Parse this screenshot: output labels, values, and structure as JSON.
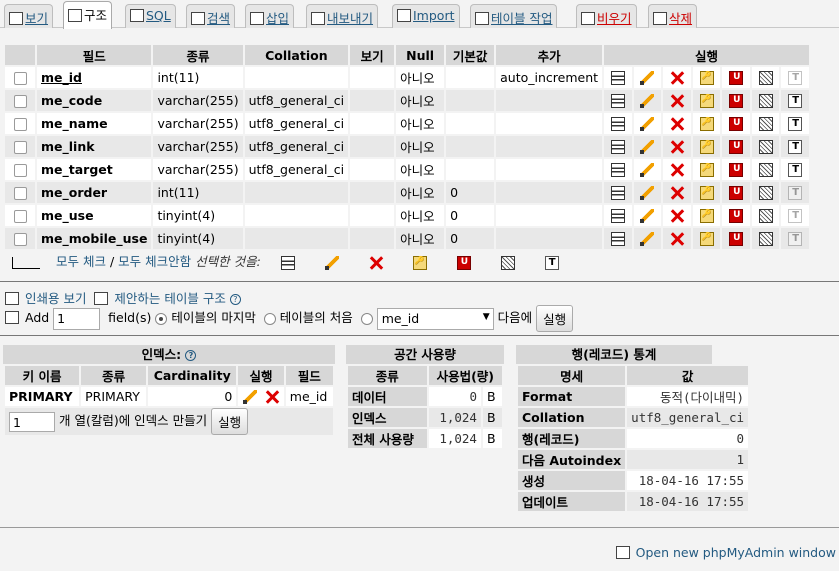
{
  "tabs": [
    {
      "label": "보기",
      "icon": "browse-icon"
    },
    {
      "label": "구조",
      "icon": "structure-icon",
      "active": true
    },
    {
      "label": "SQL",
      "icon": "sql-icon"
    },
    {
      "label": "검색",
      "icon": "search-icon"
    },
    {
      "label": "삽입",
      "icon": "insert-icon"
    },
    {
      "label": "내보내기",
      "icon": "export-icon"
    },
    {
      "label": "Import",
      "icon": "import-icon"
    },
    {
      "label": "테이블 작업",
      "icon": "operations-icon"
    },
    {
      "label": "비우기",
      "icon": "empty-icon"
    },
    {
      "label": "삭제",
      "icon": "drop-icon"
    }
  ],
  "structure": {
    "headers": {
      "field": "필드",
      "type": "종류",
      "collation": "Collation",
      "attributes": "보기",
      "null": "Null",
      "default": "기본값",
      "extra": "추가",
      "action": "실행"
    },
    "rows": [
      {
        "name": "me_id",
        "type": "int(11)",
        "collation": "",
        "attributes": "",
        "null": "아니오",
        "default": "",
        "extra": "auto_increment"
      },
      {
        "name": "me_code",
        "type": "varchar(255)",
        "collation": "utf8_general_ci",
        "attributes": "",
        "null": "아니오",
        "default": "",
        "extra": ""
      },
      {
        "name": "me_name",
        "type": "varchar(255)",
        "collation": "utf8_general_ci",
        "attributes": "",
        "null": "아니오",
        "default": "",
        "extra": ""
      },
      {
        "name": "me_link",
        "type": "varchar(255)",
        "collation": "utf8_general_ci",
        "attributes": "",
        "null": "아니오",
        "default": "",
        "extra": ""
      },
      {
        "name": "me_target",
        "type": "varchar(255)",
        "collation": "utf8_general_ci",
        "attributes": "",
        "null": "아니오",
        "default": "",
        "extra": ""
      },
      {
        "name": "me_order",
        "type": "int(11)",
        "collation": "",
        "attributes": "",
        "null": "아니오",
        "default": "0",
        "extra": ""
      },
      {
        "name": "me_use",
        "type": "tinyint(4)",
        "collation": "",
        "attributes": "",
        "null": "아니오",
        "default": "0",
        "extra": ""
      },
      {
        "name": "me_mobile_use",
        "type": "tinyint(4)",
        "collation": "",
        "attributes": "",
        "null": "아니오",
        "default": "0",
        "extra": ""
      }
    ]
  },
  "bulk": {
    "check_all": "모두 체크",
    "slash": "/",
    "uncheck_all": "모두 체크안함",
    "with_selected": "선택한 것을:"
  },
  "links": {
    "print_view": "인쇄용 보기",
    "propose_structure": "제안하는 테이블 구조"
  },
  "add_field": {
    "label": "Add",
    "count": "1",
    "fields_suffix": "field(s)",
    "at_end": "테이블의 마지막",
    "at_beginning": "테이블의 처음",
    "after_field": "me_id",
    "after_suffix": "다음에",
    "go": "실행"
  },
  "indexes": {
    "caption": "인덱스:",
    "headers": {
      "key_name": "키 이름",
      "type": "종류",
      "cardinality": "Cardinality",
      "action": "실행",
      "field": "필드"
    },
    "rows": [
      {
        "key_name": "PRIMARY",
        "type": "PRIMARY",
        "cardinality": "0",
        "field": "me_id"
      }
    ],
    "create_count": "1",
    "create_label": "개 열(칼럼)에 인덱스 만들기",
    "go": "실행"
  },
  "space": {
    "caption": "공간 사용량",
    "headers": {
      "type": "종류",
      "usage": "사용법(량)"
    },
    "rows": [
      {
        "type": "데이터",
        "value": "0",
        "unit": "B"
      },
      {
        "type": "인덱스",
        "value": "1,024",
        "unit": "B"
      },
      {
        "type": "전체 사용량",
        "value": "1,024",
        "unit": "B"
      }
    ]
  },
  "row_stats": {
    "caption": "행(레코드) 통계",
    "headers": {
      "name": "명세",
      "value": "값"
    },
    "rows": [
      {
        "name": "Format",
        "value": "동적(다이내믹)"
      },
      {
        "name": "Collation",
        "value": "utf8_general_ci"
      },
      {
        "name": "행(레코드)",
        "value": "0"
      },
      {
        "name": "다음 Autoindex",
        "value": "1"
      },
      {
        "name": "생성",
        "value": "18-04-16 17:55"
      },
      {
        "name": "업데이트",
        "value": "18-04-16 17:55"
      }
    ]
  },
  "footer": {
    "open_new_window": "Open new phpMyAdmin window"
  }
}
